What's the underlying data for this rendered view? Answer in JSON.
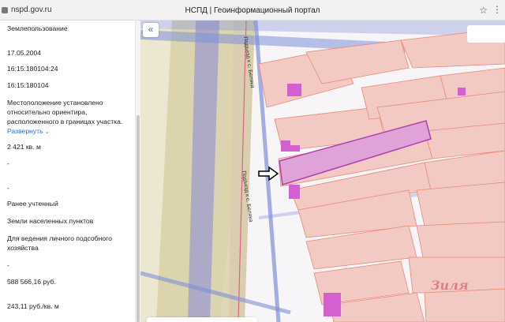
{
  "browser": {
    "url": "nspd.gov.ru",
    "title": "НСПД | Геоинформационный портал"
  },
  "panel": {
    "rows": [
      {
        "text": "Землепользование"
      },
      {
        "text": "17.05.2004"
      },
      {
        "text": "16:15:180104:24"
      },
      {
        "text": "16:15:180104"
      },
      {
        "text": "Местоположение установлено"
      },
      {
        "text": "относительно ориентира,"
      },
      {
        "text": "расположенного в границах участка."
      },
      {
        "text": "Развернуть"
      },
      {
        "text": "2 421 кв. м"
      },
      {
        "text": "-"
      },
      {
        "text": "-"
      },
      {
        "text": "Ранее учтенный"
      },
      {
        "text": "Земли населенных пунктов"
      },
      {
        "text": "Для ведения личного подсобного"
      },
      {
        "text": "хозяйства"
      },
      {
        "text": "-"
      },
      {
        "text": "588 566,16 руб."
      },
      {
        "text": "243,11 руб./кв. м"
      }
    ]
  },
  "map": {
    "street_top": "Подъезд к с. Беляка",
    "street_mid": "Подъезд к с. Беляка",
    "watermark": "Зиля",
    "colors": {
      "parcel": "#e98a78",
      "highlight": "#b040b0",
      "road": "#7f8fd8",
      "building": "#d35fd0"
    }
  }
}
